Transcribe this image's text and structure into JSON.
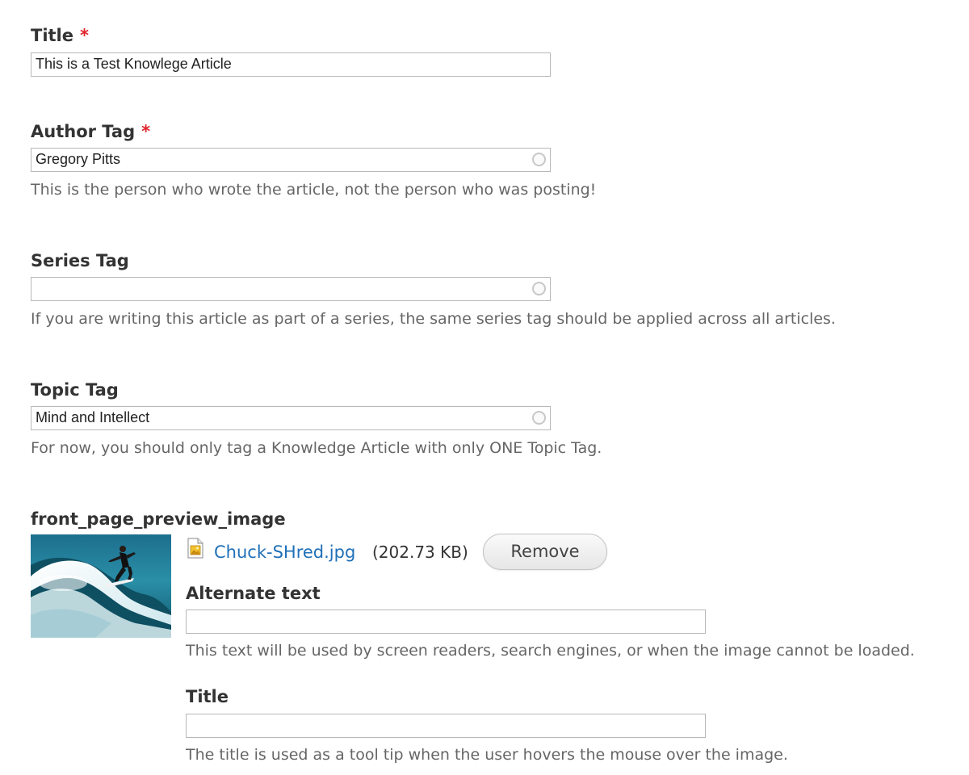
{
  "fields": {
    "title": {
      "label": "Title",
      "required_mark": "*",
      "value": ""
    },
    "author_tag": {
      "label": "Author Tag",
      "required_mark": "*",
      "value": "Gregory Pitts",
      "description": "This is the person who wrote the article, not the person who was posting!"
    },
    "series_tag": {
      "label": "Series Tag",
      "value": "",
      "description": "If you are writing this article as part of a series, the same series tag should be applied across all articles."
    },
    "topic_tag": {
      "label": "Topic Tag",
      "value": "Mind and Intellect",
      "description": "For now, you should only tag a Knowledge Article with only ONE Topic Tag."
    }
  },
  "title_value": "This is a Test Knowlege Article",
  "image_field": {
    "label": "front_page_preview_image",
    "file_name": "Chuck-SHred.jpg",
    "file_size": "(202.73 KB)",
    "remove_label": "Remove",
    "file_icon": "image-file-icon",
    "alt_text": {
      "label": "Alternate text",
      "value": "",
      "description": "This text will be used by screen readers, search engines, or when the image cannot be loaded."
    },
    "image_title": {
      "label": "Title",
      "value": "",
      "description": "The title is used as a tool tip when the user hovers the mouse over the image."
    }
  },
  "colors": {
    "required": "#e0252b",
    "link": "#1f70b8",
    "label": "#333333",
    "description": "#666666"
  }
}
